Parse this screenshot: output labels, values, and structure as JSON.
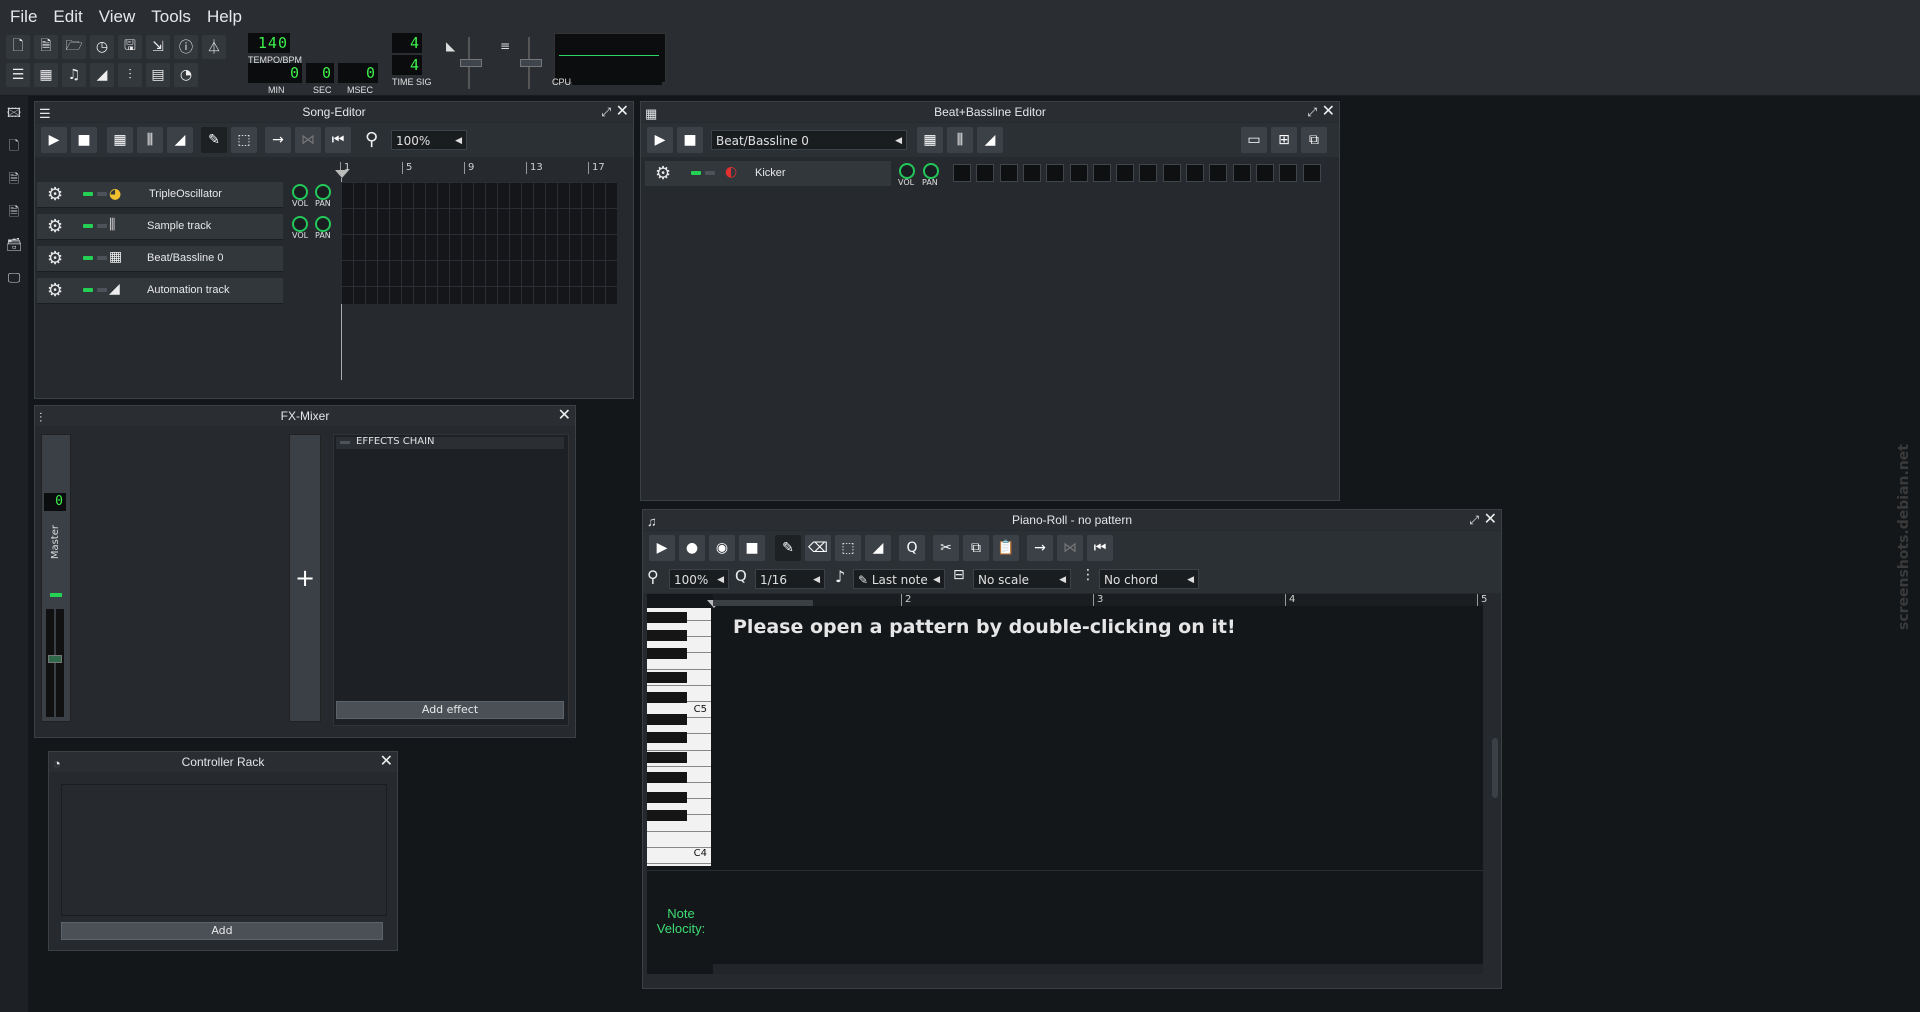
{
  "menu": [
    "File",
    "Edit",
    "View",
    "Tools",
    "Help"
  ],
  "toolbar": {
    "tempo": "140",
    "tempo_label": "TEMPO/BPM",
    "time_min": "0",
    "time_sec": "0",
    "time_msec": "0",
    "min_label": "MIN",
    "sec_label": "SEC",
    "msec_label": "MSEC",
    "timesig_num": "4",
    "timesig_den": "4",
    "timesig_label": "TIME SIG",
    "cpu_label": "CPU"
  },
  "song_editor": {
    "title": "Song-Editor",
    "zoom": "100%",
    "ruler": [
      "1",
      "5",
      "9",
      "13",
      "17"
    ],
    "tracks": [
      {
        "name": "TripleOscillator",
        "icon": "oscillator-icon",
        "knobs": true
      },
      {
        "name": "Sample track",
        "icon": "waveform-icon",
        "knobs": true
      },
      {
        "name": "Beat/Bassline 0",
        "icon": "beat-grid-icon",
        "knobs": false
      },
      {
        "name": "Automation track",
        "icon": "automation-ramp-icon",
        "knobs": false
      }
    ],
    "vol_label": "VOL",
    "pan_label": "PAN"
  },
  "bb_editor": {
    "title": "Beat+Bassline Editor",
    "pattern": "Beat/Bassline 0",
    "track_name": "Kicker",
    "vol_label": "VOL",
    "pan_label": "PAN",
    "steps": 16
  },
  "fx_mixer": {
    "title": "FX-Mixer",
    "master_label": "Master",
    "channel_number": "0",
    "effects_chain_label": "EFFECTS CHAIN",
    "add_effect_label": "Add effect"
  },
  "controller_rack": {
    "title": "Controller Rack",
    "add_label": "Add"
  },
  "piano_roll": {
    "title": "Piano-Roll - no pattern",
    "zoom": "100%",
    "quantize": "1/16",
    "note_length": "Last note",
    "scale": "No scale",
    "chord": "No chord",
    "ruler": [
      "2",
      "3",
      "4",
      "5"
    ],
    "message": "Please open a pattern by double-clicking on it!",
    "key_c5": "C5",
    "key_c4": "C4",
    "note_velocity_label": "Note\nVelocity:"
  },
  "colors": {
    "accent": "#25d154",
    "lcd": "#3cf04a",
    "bg": "#14171a"
  }
}
